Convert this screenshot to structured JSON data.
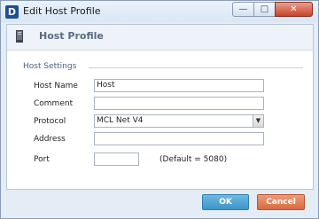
{
  "window": {
    "title": "Edit Host Profile",
    "app_icon_letter": "D",
    "minimize_glyph": "—",
    "maximize_glyph": "□",
    "close_glyph": "✕"
  },
  "header": {
    "title": "Host Profile",
    "icon": "computer-tower-icon"
  },
  "group": {
    "title": "Host Settings"
  },
  "fields": {
    "host_name": {
      "label": "Host Name",
      "value": "Host"
    },
    "comment": {
      "label": "Comment",
      "value": ""
    },
    "protocol": {
      "label": "Protocol",
      "value": "MCL Net V4"
    },
    "address": {
      "label": "Address",
      "value": ""
    },
    "port": {
      "label": "Port",
      "value": "",
      "hint": "(Default = 5080)"
    }
  },
  "buttons": {
    "ok": "OK",
    "cancel": "Cancel"
  },
  "colors": {
    "ok_button": "#4aa3d6",
    "cancel_button": "#e07a4e",
    "titlebar": "#dfe9f5"
  }
}
